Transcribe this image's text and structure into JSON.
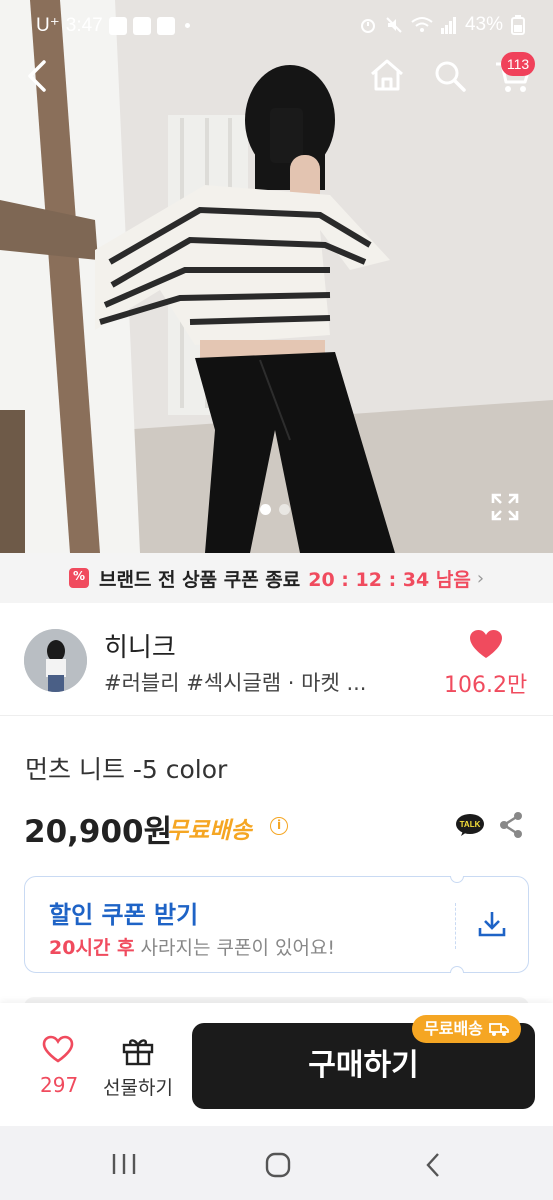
{
  "status_bar": {
    "carrier": "U⁺",
    "time": "3:47",
    "battery": "43%"
  },
  "nav": {
    "back_icon": "chevron-left-icon",
    "home_icon": "home-icon",
    "search_icon": "search-icon",
    "cart_icon": "cart-icon",
    "cart_count": "113"
  },
  "gallery": {
    "page_count": 2,
    "current_page": 1
  },
  "promo": {
    "text": "브랜드 전 상품 쿠폰 종료",
    "timer": "20 : 12 : 34 남음"
  },
  "store": {
    "name": "히니크",
    "tags": "#러블리 #섹시글램 · 마켓 ...",
    "likes": "106.2만"
  },
  "product": {
    "title": "먼츠 니트 -5 color",
    "price": "20,900원",
    "shipping": "무료배송"
  },
  "coupon": {
    "title": "할인 쿠폰 받기",
    "highlight": "20시간 후",
    "subtitle": " 사라지는 쿠폰이 있어요!"
  },
  "bottom_bar": {
    "like_count": "297",
    "gift_label": "선물하기",
    "buy_label": "구매하기",
    "buy_badge": "무료배송"
  },
  "colors": {
    "accent_pink": "#f04b5e",
    "coupon_blue": "#1e63c6",
    "shipping_orange": "#f5a623"
  }
}
